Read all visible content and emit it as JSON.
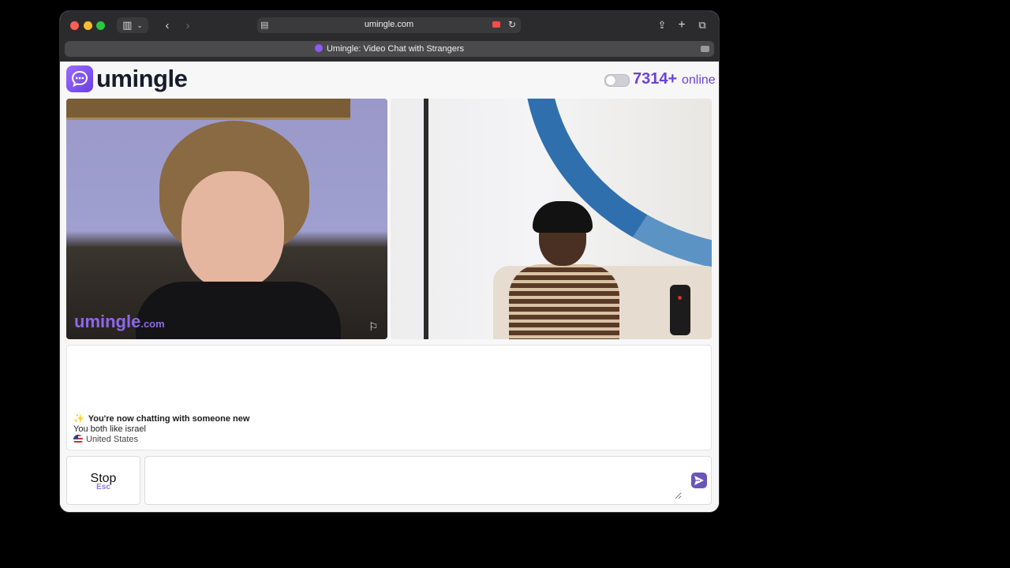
{
  "browser": {
    "url": "umingle.com",
    "tab_title": "Umingle: Video Chat with Strangers"
  },
  "header": {
    "logo_text": "umingle",
    "online_count": "7314+",
    "online_label": "online"
  },
  "video": {
    "watermark_brand": "umingle",
    "watermark_domain": ".com"
  },
  "chat": {
    "new_chat_message": "You're now chatting with someone new",
    "shared_interest": "You both like israel",
    "country": "United States"
  },
  "controls": {
    "stop_label": "Stop",
    "stop_shortcut": "Esc",
    "message_placeholder": ""
  },
  "colors": {
    "brand": "#6a43d8",
    "send_button": "#6b55b8"
  }
}
